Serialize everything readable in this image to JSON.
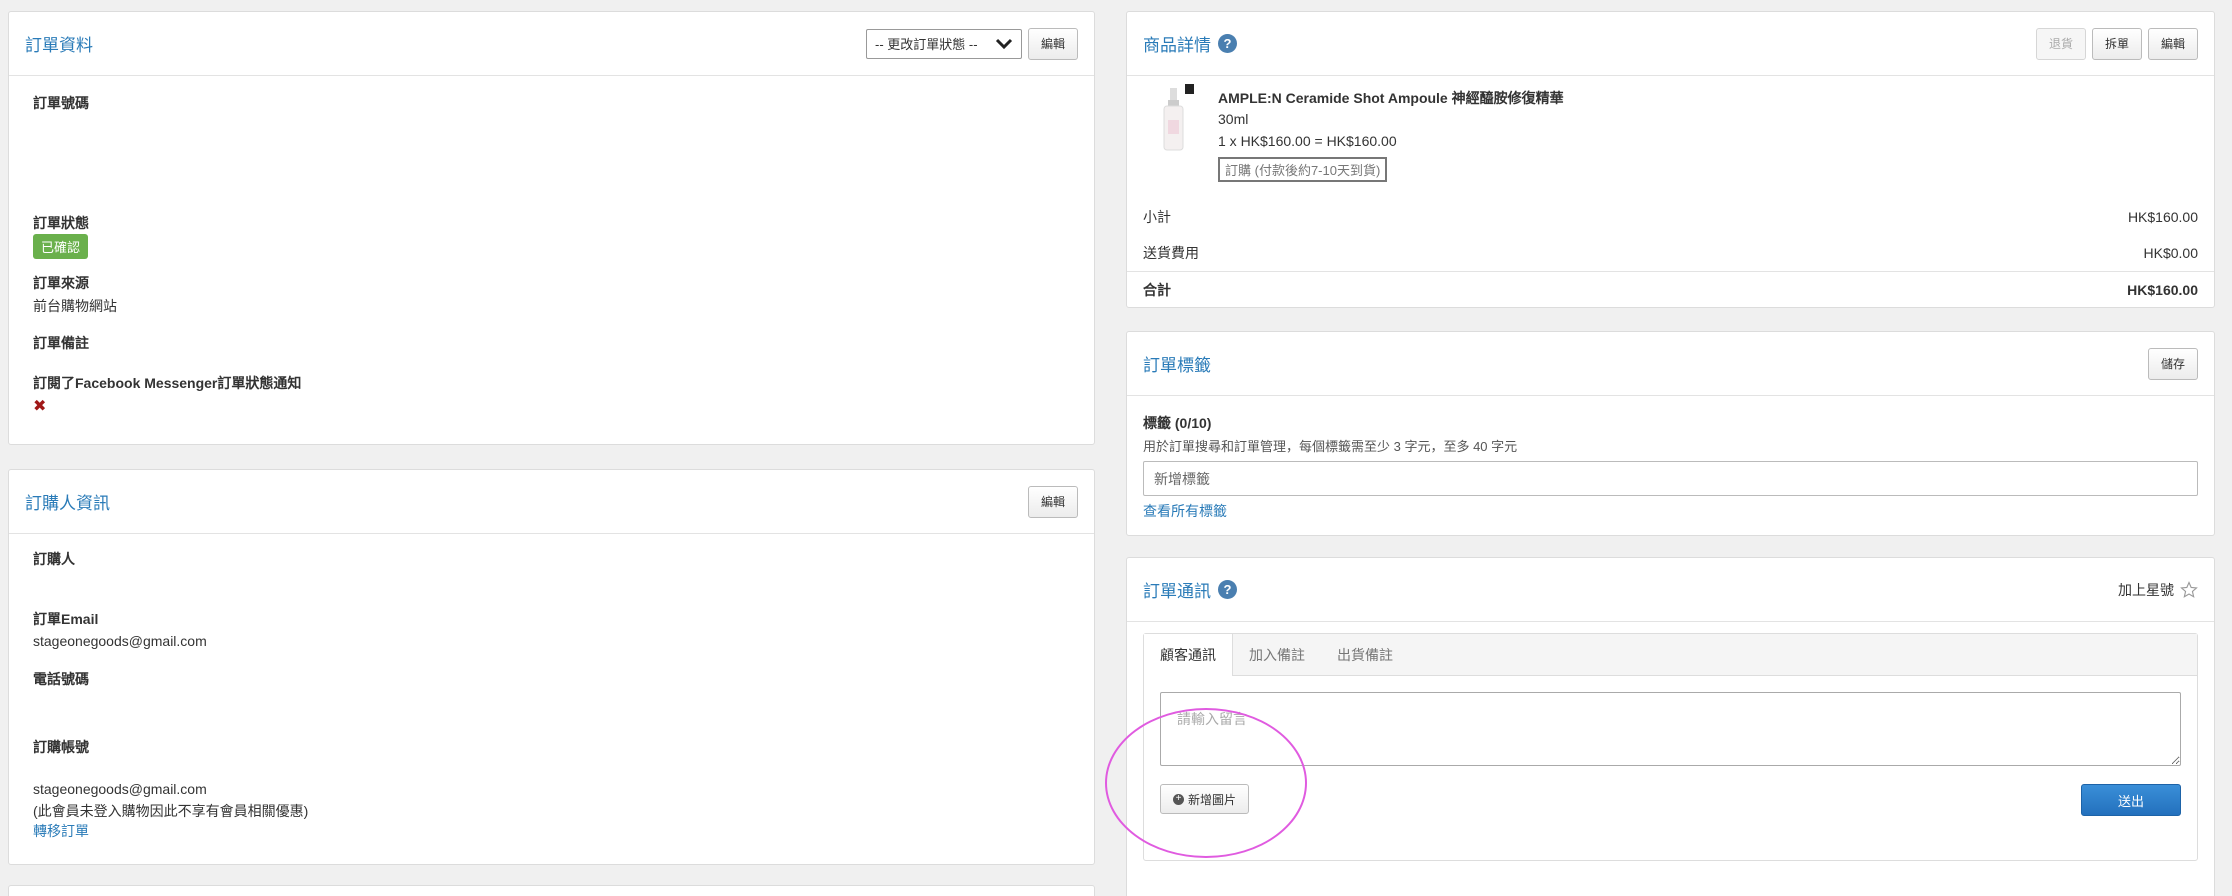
{
  "order_info": {
    "title": "訂單資料",
    "status_select": "-- 更改訂單狀態 --",
    "edit_label": "編輯",
    "order_no_label": "訂單號碼",
    "status_label": "訂單狀態",
    "status_badge": "已確認",
    "source_label": "訂單來源",
    "source_value": "前台購物網站",
    "remark_label": "訂單備註",
    "fb_label": "訂閱了Facebook Messenger訂單狀態通知",
    "fb_value": "✖"
  },
  "buyer_info": {
    "title": "訂購人資訊",
    "edit_label": "編輯",
    "buyer_label": "訂購人",
    "email_label": "訂單Email",
    "email_value": "stageonegoods@gmail.com",
    "phone_label": "電話號碼",
    "account_label": "訂購帳號",
    "account_value": "stageonegoods@gmail.com",
    "account_note": "(此會員未登入購物因此不享有會員相關優惠)",
    "transfer_link": "轉移訂單"
  },
  "product_details": {
    "title": "商品詳情",
    "help_icon": "?",
    "return_label": "退貨",
    "split_label": "拆單",
    "edit_label": "編輯",
    "item": {
      "name": "AMPLE:N Ceramide Shot Ampoule 神經醯胺修復精華",
      "variant": "30ml",
      "price_line": "1 x HK$160.00 = HK$160.00",
      "preorder_tag": "訂購 (付款後約7-10天到貨)"
    },
    "subtotal_label": "小計",
    "subtotal_value": "HK$160.00",
    "shipping_label": "送貨費用",
    "shipping_value": "HK$0.00",
    "total_label": "合計",
    "total_value": "HK$160.00"
  },
  "order_tags": {
    "title": "訂單標籤",
    "save_label": "儲存",
    "tags_label": "標籤 (0/10)",
    "tags_hint": "用於訂單搜尋和訂單管理，每個標籤需至少 3 字元，至多 40 字元",
    "input_placeholder": "新增標籤",
    "view_all_link": "查看所有標籤"
  },
  "order_messages": {
    "title": "訂單通訊",
    "help_icon": "?",
    "star_label": "加上星號",
    "tabs": [
      {
        "label": "顧客通訊"
      },
      {
        "label": "加入備註"
      },
      {
        "label": "出貨備註"
      }
    ],
    "message_placeholder": "請輸入留言",
    "add_image_label": "新增圖片",
    "send_label": "送出"
  },
  "colors": {
    "accent": "#2a7bb8",
    "status_green": "#6ab04c",
    "highlight": "#e05be0"
  }
}
